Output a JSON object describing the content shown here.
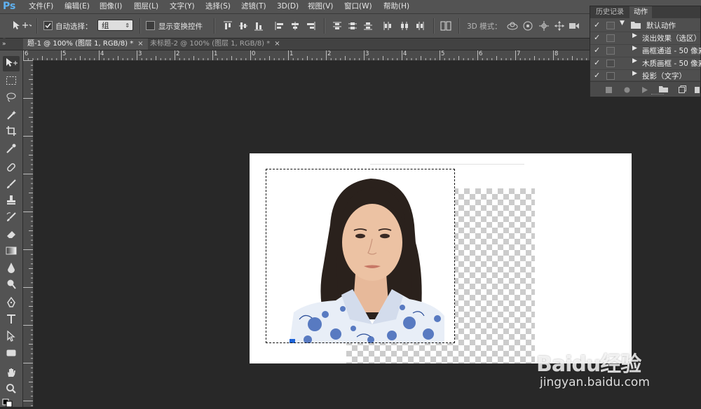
{
  "app": {
    "logo": "Ps",
    "accent": "#5fb1f0"
  },
  "menu": [
    "文件(F)",
    "编辑(E)",
    "图像(I)",
    "图层(L)",
    "文字(Y)",
    "选择(S)",
    "滤镜(T)",
    "3D(D)",
    "视图(V)",
    "窗口(W)",
    "帮助(H)"
  ],
  "options": {
    "auto_select_label": "自动选择：",
    "auto_select_checked": true,
    "auto_select_value": "组",
    "show_transform_label": "显示变换控件",
    "show_transform_checked": false,
    "mode_3d_label": "3D 模式："
  },
  "tabs": [
    {
      "label": "题-1 @ 100% (图层 1, RGB/8) *",
      "close": "×",
      "active": true
    },
    {
      "label": "未标题-2 @ 100% (图层 1, RGB/8) *",
      "close": "×",
      "active": false
    }
  ],
  "ruler": {
    "top_numbers": [
      "6",
      "5",
      "4",
      "3",
      "2",
      "1",
      "0",
      "1",
      "2",
      "3",
      "4",
      "5",
      "6",
      "7",
      "8",
      "9"
    ]
  },
  "tools": [
    "move-icon",
    "marquee-icon",
    "lasso-icon",
    "magic-wand-icon",
    "crop-icon",
    "eyedropper-icon",
    "healing-brush-icon",
    "brush-icon",
    "stamp-icon",
    "history-brush-icon",
    "eraser-icon",
    "gradient-icon",
    "blur-icon",
    "dodge-icon",
    "pen-icon",
    "type-icon",
    "path-select-icon",
    "shape-icon",
    "hand-icon",
    "zoom-icon"
  ],
  "panel": {
    "tab_history": "历史记录",
    "tab_actions": "动作",
    "actions": [
      {
        "label": "默认动作",
        "checked": true,
        "expanded": true,
        "folder": true
      },
      {
        "label": "淡出效果（选区）",
        "checked": true,
        "expanded": false,
        "folder": false
      },
      {
        "label": "画框通道 - 50 像素",
        "checked": true,
        "expanded": false,
        "folder": false
      },
      {
        "label": "木质画框 - 50 像素",
        "checked": true,
        "expanded": false,
        "folder": false
      },
      {
        "label": "投影（文字）",
        "checked": true,
        "expanded": false,
        "folder": false
      }
    ]
  },
  "watermark": {
    "logo": "Baidu经验",
    "url": "jingyan.baidu.com"
  }
}
